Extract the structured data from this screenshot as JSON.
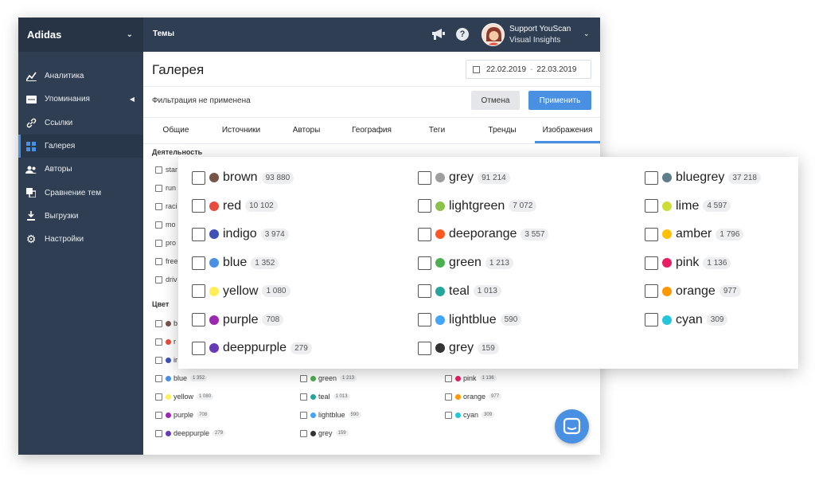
{
  "sidebar": {
    "brand": "Adidas",
    "items": [
      {
        "label": "Аналитика",
        "icon": "chart-icon"
      },
      {
        "label": "Упоминания",
        "icon": "mentions-icon"
      },
      {
        "label": "Ссылки",
        "icon": "link-icon"
      },
      {
        "label": "Галерея",
        "icon": "gallery-icon",
        "active": true
      },
      {
        "label": "Авторы",
        "icon": "users-icon"
      },
      {
        "label": "Сравнение тем",
        "icon": "compare-icon"
      },
      {
        "label": "Выгрузки",
        "icon": "download-icon"
      },
      {
        "label": "Настройки",
        "icon": "gear-icon"
      }
    ]
  },
  "topbar": {
    "title": "Темы",
    "user_name": "Support YouScan",
    "user_sub": "Visual Insights",
    "help_glyph": "?"
  },
  "main": {
    "page_title": "Галерея",
    "date_from": "22.02.2019",
    "date_sep": "-",
    "date_to": "22.03.2019",
    "filter_status": "Фильтрация не применена",
    "cancel_label": "Отмена",
    "apply_label": "Применить",
    "tabs": [
      "Общие",
      "Источники",
      "Авторы",
      "География",
      "Теги",
      "Тренды",
      "Изображения"
    ],
    "active_tab": "Изображения",
    "activity_title": "Деятельность",
    "activity_items": [
      "star",
      "run",
      "raci",
      "mo",
      "pro",
      "free",
      "driv"
    ],
    "color_title": "Цвет",
    "color_partial": [
      "b",
      "r",
      "ir"
    ]
  },
  "colors": [
    {
      "name": "brown",
      "count": "93 880",
      "hex": "#795548"
    },
    {
      "name": "red",
      "count": "10 102",
      "hex": "#e74c3c"
    },
    {
      "name": "indigo",
      "count": "3 974",
      "hex": "#3f51b5"
    },
    {
      "name": "blue",
      "count": "1 352",
      "hex": "#4a90e2"
    },
    {
      "name": "yellow",
      "count": "1 080",
      "hex": "#ffee58"
    },
    {
      "name": "purple",
      "count": "708",
      "hex": "#9c27b0"
    },
    {
      "name": "deeppurple",
      "count": "279",
      "hex": "#673ab7"
    },
    {
      "name": "grey",
      "count": "91 214",
      "hex": "#9e9e9e"
    },
    {
      "name": "lightgreen",
      "count": "7 072",
      "hex": "#8bc34a"
    },
    {
      "name": "deeporange",
      "count": "3 557",
      "hex": "#ff5722"
    },
    {
      "name": "green",
      "count": "1 213",
      "hex": "#4caf50"
    },
    {
      "name": "teal",
      "count": "1 013",
      "hex": "#26a69a"
    },
    {
      "name": "lightblue",
      "count": "590",
      "hex": "#42a5f5"
    },
    {
      "name": "grey",
      "count": "159",
      "hex": "#333333"
    },
    {
      "name": "bluegrey",
      "count": "37 218",
      "hex": "#607d8b"
    },
    {
      "name": "lime",
      "count": "4 597",
      "hex": "#cddc39"
    },
    {
      "name": "amber",
      "count": "1 796",
      "hex": "#ffc107"
    },
    {
      "name": "pink",
      "count": "1 136",
      "hex": "#e91e63"
    },
    {
      "name": "orange",
      "count": "977",
      "hex": "#ff9800"
    },
    {
      "name": "cyan",
      "count": "309",
      "hex": "#26c6da"
    }
  ]
}
